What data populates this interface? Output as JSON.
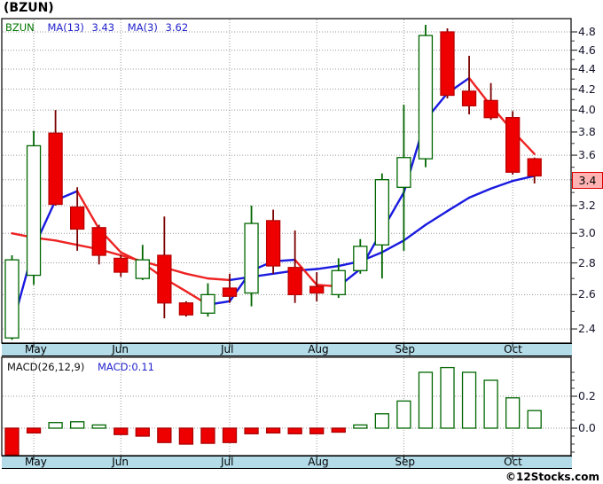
{
  "header": {
    "symbol_title": "(BZUN)"
  },
  "price_pane": {
    "legend": {
      "symbol": "BZUN",
      "ma13_label": "MA(13)",
      "ma13_value": "3.43",
      "ma3_label": "MA(3)",
      "ma3_value": "3.62"
    },
    "axis_labels": [
      "4.8",
      "4.6",
      "4.4",
      "4.2",
      "4.0",
      "3.8",
      "3.6",
      "3.4",
      "3.2",
      "3.0",
      "2.8",
      "2.6",
      "2.4"
    ],
    "last_price_tag": "3.4"
  },
  "macd_pane": {
    "label": "MACD(26,12,9)",
    "value_label": "MACD:0.11",
    "axis_labels": [
      "0.2",
      "0.0"
    ]
  },
  "months": [
    "May",
    "Jun",
    "Jul",
    "Aug",
    "Sep",
    "Oct"
  ],
  "footer": {
    "credit": "©12Stocks.com"
  },
  "colors": {
    "up_candle_border": "#006600",
    "up_candle_fill": "#ffffff",
    "down_candle_fill": "#ee0000",
    "down_candle_border": "#bb0000",
    "down_wick": "#7a0000",
    "ma_rising": "#1a1ae0",
    "ma_falling": "#ee2222",
    "grid": "#999999",
    "month_band_bg": "#b3dbe8",
    "legend_blue": "#2222cc",
    "symbol_green": "#007700",
    "tag_bg": "#ffb3b3",
    "tag_border": "#dd0000",
    "axis_text": "#14142b"
  },
  "chart_data": {
    "type": "candlestick_with_macd_panel",
    "symbol": "BZUN",
    "interval": "weekly",
    "price_scale": "log",
    "price_tick_values": [
      4.8,
      4.6,
      4.4,
      4.2,
      4.0,
      3.8,
      3.6,
      3.4,
      3.2,
      3.0,
      2.8,
      2.6,
      2.4
    ],
    "month_start_candle_indices": [
      1,
      5,
      10,
      14,
      18,
      23
    ],
    "last_price": 3.4,
    "candles": [
      {
        "o": 2.35,
        "h": 2.85,
        "l": 2.34,
        "c": 2.82
      },
      {
        "o": 2.72,
        "h": 3.81,
        "l": 2.66,
        "c": 3.68
      },
      {
        "o": 3.79,
        "h": 4.0,
        "l": 3.2,
        "c": 3.21
      },
      {
        "o": 3.19,
        "h": 3.34,
        "l": 2.88,
        "c": 3.03
      },
      {
        "o": 3.04,
        "h": 3.06,
        "l": 2.79,
        "c": 2.85
      },
      {
        "o": 2.83,
        "h": 2.85,
        "l": 2.71,
        "c": 2.74
      },
      {
        "o": 2.7,
        "h": 2.92,
        "l": 2.69,
        "c": 2.82
      },
      {
        "o": 2.85,
        "h": 3.12,
        "l": 2.46,
        "c": 2.55
      },
      {
        "o": 2.55,
        "h": 2.56,
        "l": 2.47,
        "c": 2.48
      },
      {
        "o": 2.49,
        "h": 2.67,
        "l": 2.47,
        "c": 2.6
      },
      {
        "o": 2.64,
        "h": 2.73,
        "l": 2.55,
        "c": 2.59
      },
      {
        "o": 2.61,
        "h": 3.2,
        "l": 2.53,
        "c": 3.07
      },
      {
        "o": 3.09,
        "h": 3.17,
        "l": 2.73,
        "c": 2.78
      },
      {
        "o": 2.77,
        "h": 3.02,
        "l": 2.55,
        "c": 2.6
      },
      {
        "o": 2.65,
        "h": 2.74,
        "l": 2.56,
        "c": 2.61
      },
      {
        "o": 2.6,
        "h": 2.83,
        "l": 2.58,
        "c": 2.75
      },
      {
        "o": 2.75,
        "h": 2.96,
        "l": 2.73,
        "c": 2.91
      },
      {
        "o": 2.92,
        "h": 3.45,
        "l": 2.7,
        "c": 3.4
      },
      {
        "o": 3.34,
        "h": 4.05,
        "l": 2.88,
        "c": 3.58
      },
      {
        "o": 3.57,
        "h": 4.88,
        "l": 3.5,
        "c": 4.76
      },
      {
        "o": 4.8,
        "h": 4.84,
        "l": 4.11,
        "c": 4.14
      },
      {
        "o": 4.18,
        "h": 4.54,
        "l": 3.96,
        "c": 4.04
      },
      {
        "o": 4.09,
        "h": 4.26,
        "l": 3.91,
        "c": 3.93
      },
      {
        "o": 3.93,
        "h": 3.99,
        "l": 3.44,
        "c": 3.46
      },
      {
        "o": 3.57,
        "h": 3.58,
        "l": 3.37,
        "c": 3.43
      }
    ],
    "ma3": [
      2.41,
      2.9,
      3.24,
      3.31,
      3.03,
      2.87,
      2.8,
      2.7,
      2.62,
      2.54,
      2.56,
      2.75,
      2.81,
      2.82,
      2.66,
      2.65,
      2.76,
      3.02,
      3.3,
      3.91,
      4.16,
      4.31,
      4.04,
      3.81,
      3.61
    ],
    "ma13": [
      3.0,
      2.97,
      2.95,
      2.92,
      2.89,
      2.85,
      2.81,
      2.77,
      2.73,
      2.7,
      2.69,
      2.71,
      2.73,
      2.75,
      2.76,
      2.78,
      2.81,
      2.87,
      2.95,
      3.06,
      3.16,
      3.26,
      3.33,
      3.39,
      3.43
    ],
    "macd": [
      -0.18,
      -0.03,
      0.035,
      0.04,
      0.02,
      -0.04,
      -0.05,
      -0.09,
      -0.1,
      -0.095,
      -0.09,
      -0.035,
      -0.03,
      -0.035,
      -0.035,
      -0.025,
      0.02,
      0.09,
      0.17,
      0.35,
      0.38,
      0.35,
      0.3,
      0.19,
      0.11
    ],
    "macd_labeled_ticks": [
      0.2,
      0.0
    ],
    "macd_minor_tick_step": 0.05,
    "macd_tick_range": [
      0.35,
      -0.15
    ]
  }
}
